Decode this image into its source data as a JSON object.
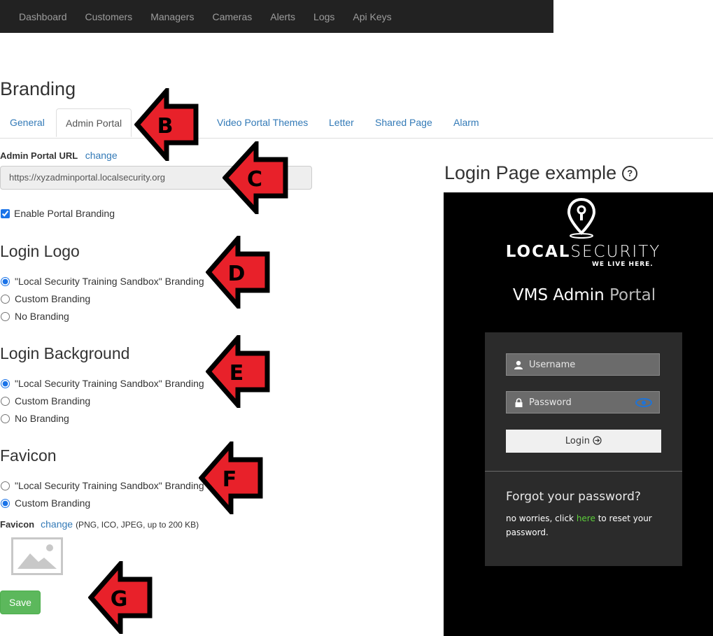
{
  "nav": {
    "items": [
      "Dashboard",
      "Customers",
      "Managers",
      "Cameras",
      "Alerts",
      "Logs",
      "Api Keys"
    ]
  },
  "page": {
    "title": "Branding"
  },
  "tabs": {
    "items": [
      "General",
      "Admin Portal",
      "Video Portal Themes",
      "Letter",
      "Shared Page",
      "Alarm"
    ],
    "active": "Admin Portal"
  },
  "admin_url": {
    "label": "Admin Portal URL",
    "change_label": "change",
    "value": "https://xyzadminportal.localsecurity.org"
  },
  "enable_branding": {
    "label": "Enable Portal Branding",
    "checked": true
  },
  "login_logo": {
    "heading": "Login Logo",
    "options": [
      "\"Local Security Training Sandbox\" Branding",
      "Custom Branding",
      "No Branding"
    ],
    "selected": "\"Local Security Training Sandbox\" Branding"
  },
  "login_background": {
    "heading": "Login Background",
    "options": [
      "\"Local Security Training Sandbox\" Branding",
      "Custom Branding",
      "No Branding"
    ],
    "selected": "\"Local Security Training Sandbox\" Branding"
  },
  "favicon": {
    "heading": "Favicon",
    "options": [
      "\"Local Security Training Sandbox\" Branding",
      "Custom Branding"
    ],
    "selected": "Custom Branding",
    "field_label": "Favicon",
    "change_label": "change",
    "hint": "(PNG, ICO, JPEG, up to 200 KB)"
  },
  "save_label": "Save",
  "preview": {
    "title": "Login Page example",
    "help_icon": "question-circle-icon",
    "brand_bold": "LOCAL",
    "brand_light": "SECURITY",
    "brand_tag": "WE LIVE HERE.",
    "portal_main": "VMS Admin",
    "portal_light": "Portal",
    "username_placeholder": "Username",
    "password_placeholder": "Password",
    "login_label": "Login",
    "forgot_title": "Forgot your password?",
    "forgot_pre": "no worries, click",
    "forgot_link": "here",
    "forgot_post": "to reset your password."
  },
  "annotations": [
    "B",
    "C",
    "D",
    "E",
    "F",
    "G"
  ],
  "colors": {
    "navbar": "#222222",
    "link": "#337ab7",
    "save": "#5cb85c",
    "arrow_fill": "#e8212a",
    "here_link": "#5dcf3b"
  }
}
